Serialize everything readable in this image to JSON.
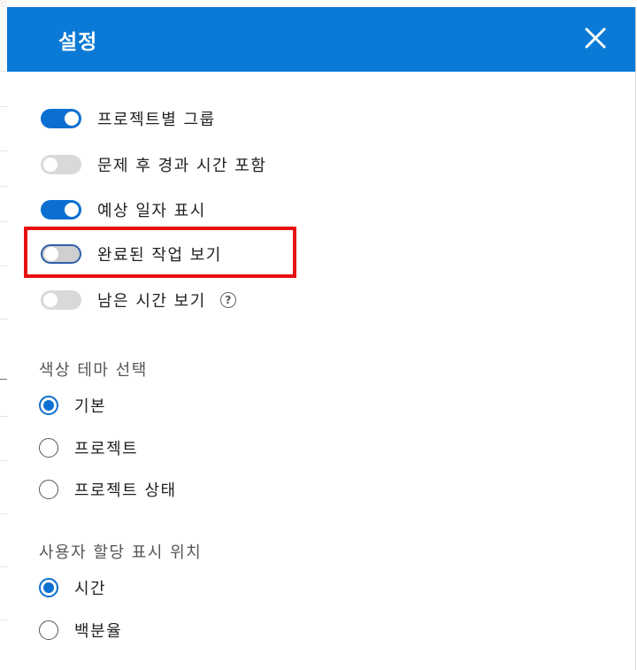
{
  "panel": {
    "title": "설정",
    "close_icon": "close-icon"
  },
  "toggles": [
    {
      "label": "프로젝트별 그룹",
      "on": true
    },
    {
      "label": "문제 후 경과 시간 포함",
      "on": false
    },
    {
      "label": "예상 일자 표시",
      "on": true
    },
    {
      "label": "완료된 작업 보기",
      "on": false,
      "focused": true
    },
    {
      "label": "남은 시간 보기",
      "on": false,
      "help": "?"
    }
  ],
  "color_theme": {
    "title": "색상 테마 선택",
    "options": [
      {
        "label": "기본",
        "checked": true
      },
      {
        "label": "프로젝트",
        "checked": false
      },
      {
        "label": "프로젝트 상태",
        "checked": false
      }
    ]
  },
  "assignment": {
    "title": "사용자 할당 표시 위치",
    "options": [
      {
        "label": "시간",
        "checked": true
      },
      {
        "label": "백분율",
        "checked": false
      }
    ]
  },
  "colors": {
    "header": "#0b7ad6",
    "accent": "#0b6fd1",
    "highlight": "#e81010"
  }
}
